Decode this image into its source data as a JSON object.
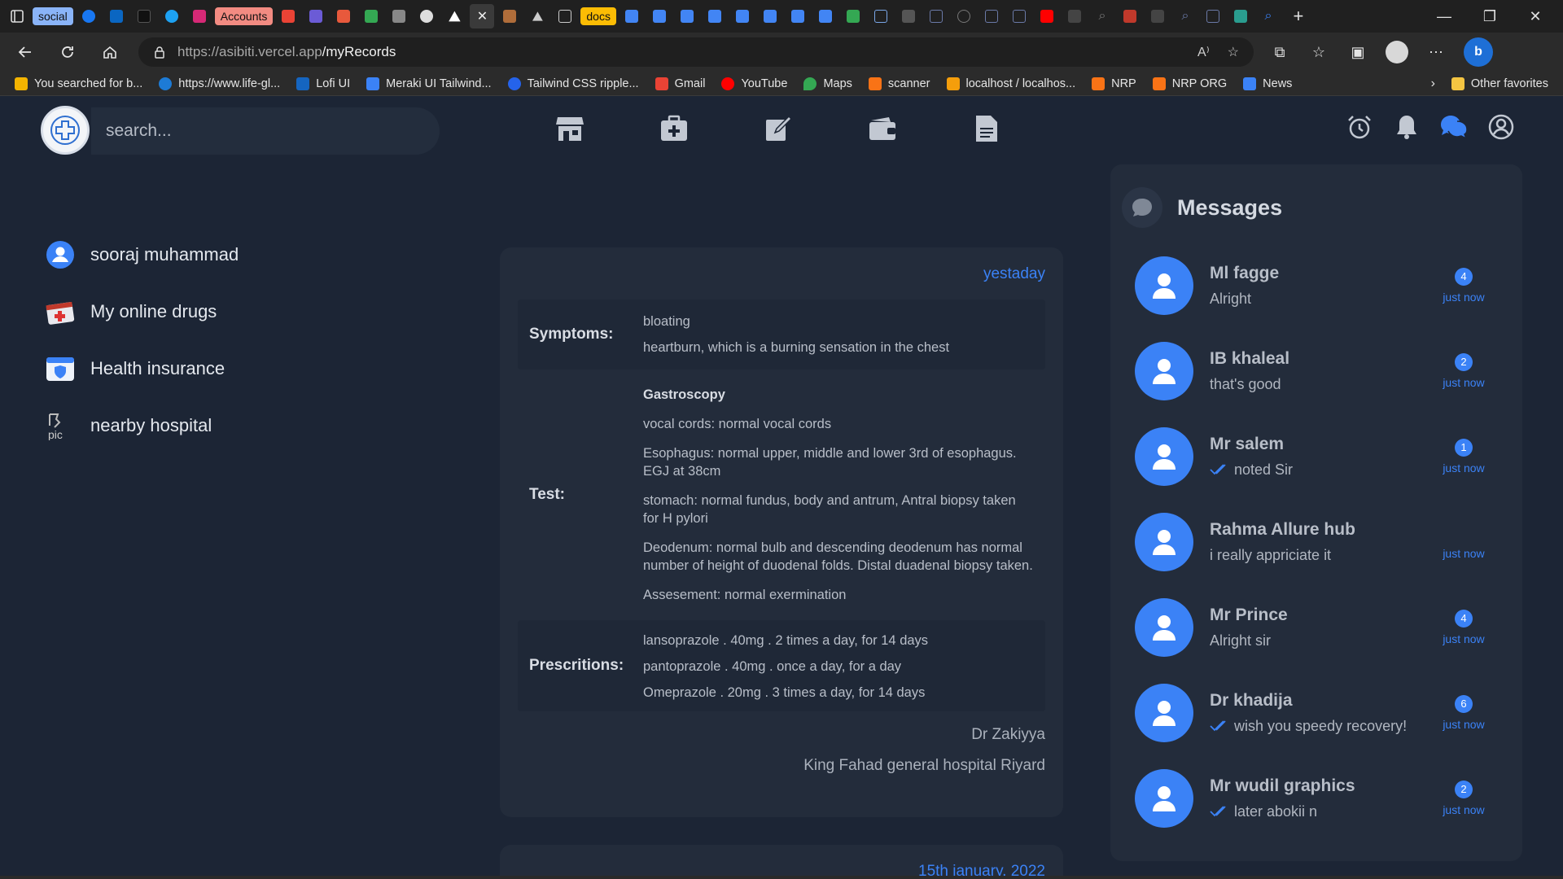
{
  "browser": {
    "tab_groups": [
      "social",
      "Accounts",
      "docs"
    ],
    "url_host": "https://asibiti.vercel.app",
    "url_path": "/myRecords",
    "favorites": [
      {
        "label": "You searched for b...",
        "color": "#f4b400"
      },
      {
        "label": "https://www.life-gl...",
        "color": "#1d7bd6"
      },
      {
        "label": "Lofi UI",
        "color": "#1565c0"
      },
      {
        "label": "Meraki UI Tailwind...",
        "color": "#3b82f6"
      },
      {
        "label": "Tailwind CSS ripple...",
        "color": "#2563eb"
      },
      {
        "label": "Gmail",
        "color": "#ea4335"
      },
      {
        "label": "YouTube",
        "color": "#ff0000"
      },
      {
        "label": "Maps",
        "color": "#34a853"
      },
      {
        "label": "scanner",
        "color": "#f97316"
      },
      {
        "label": "localhost / localhos...",
        "color": "#f59e0b"
      },
      {
        "label": "NRP",
        "color": "#f97316"
      },
      {
        "label": "NRP ORG",
        "color": "#f97316"
      },
      {
        "label": "News",
        "color": "#3b82f6"
      }
    ],
    "other_favorites": "Other favorites"
  },
  "app": {
    "search_placeholder": "search...",
    "sidebar": [
      {
        "label": "sooraj muhammad",
        "icon": "user-avatar-icon"
      },
      {
        "label": "My online drugs",
        "icon": "medical-kit-icon"
      },
      {
        "label": "Health insurance",
        "icon": "insurance-shield-icon"
      },
      {
        "label": "nearby hospital",
        "icon": "broken-image-icon"
      }
    ],
    "record": {
      "date": "yestaday",
      "symptoms_label": "Symptoms:",
      "symptoms": [
        "bloating",
        "heartburn, which is a burning sensation in the chest"
      ],
      "test_label": "Test:",
      "test_title": "Gastroscopy",
      "tests": [
        "vocal cords: normal vocal cords",
        "Esophagus: normal upper, middle and lower 3rd of esophagus. EGJ at 38cm",
        "stomach: normal fundus, body and antrum, Antral biopsy taken for H pylori",
        "Deodenum: normal bulb and descending deodenum has normal number of height of duodenal folds. Distal duadenal biopsy taken.",
        "Assesement: normal exermination"
      ],
      "prescriptions_label": "Prescritions:",
      "prescriptions": [
        "lansoprazole . 40mg . 2 times a day, for 14 days",
        "pantoprazole . 40mg . once a day, for a day",
        "Omeprazole . 20mg . 3 times a day, for 14 days"
      ],
      "doctor": "Dr Zakiyya",
      "hospital": "King Fahad general hospital Riyard"
    },
    "record2_date": "15th january, 2022",
    "messages_title": "Messages",
    "messages": [
      {
        "name": "Ml fagge",
        "preview": "Alright",
        "badge": "4",
        "time": "just now",
        "check": false
      },
      {
        "name": "IB khaleal",
        "preview": "that's good",
        "badge": "2",
        "time": "just now",
        "check": false
      },
      {
        "name": "Mr salem",
        "preview": "noted Sir",
        "badge": "1",
        "time": "just now",
        "check": true
      },
      {
        "name": "Rahma Allure hub",
        "preview": "i really appriciate it",
        "badge": "",
        "time": "just now",
        "check": false
      },
      {
        "name": "Mr Prince",
        "preview": "Alright sir",
        "badge": "4",
        "time": "just now",
        "check": false
      },
      {
        "name": "Dr khadija",
        "preview": "wish you speedy recovery!",
        "badge": "6",
        "time": "just now",
        "check": true
      },
      {
        "name": "Mr wudil graphics",
        "preview": "later abokii n",
        "badge": "2",
        "time": "just now",
        "check": true
      }
    ],
    "colors": {
      "accent": "#3b82f6",
      "background": "#1c2535",
      "card": "#232c3b"
    }
  }
}
